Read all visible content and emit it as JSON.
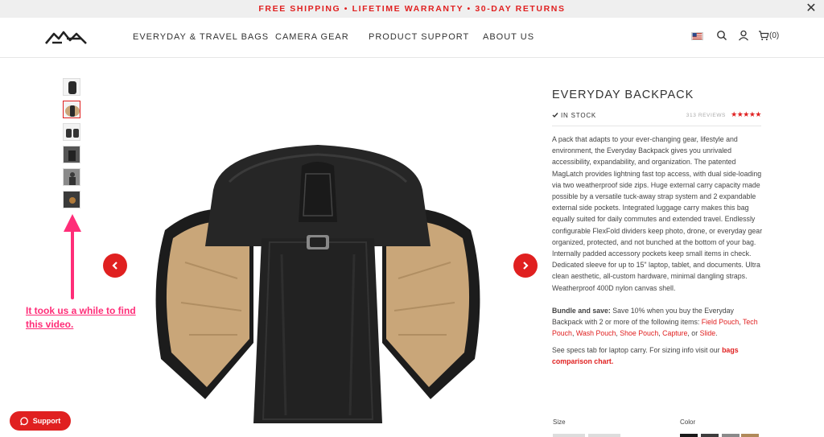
{
  "promo": {
    "text": "FREE SHIPPING • LIFETIME WARRANTY • 30-DAY RETURNS"
  },
  "header": {
    "nav": [
      {
        "label": "EVERYDAY & TRAVEL BAGS"
      },
      {
        "label": "CAMERA GEAR"
      },
      {
        "label": "PRODUCT SUPPORT"
      },
      {
        "label": "ABOUT US"
      }
    ],
    "cart_count": "(0)",
    "icons": [
      "flag-us-icon",
      "search-icon",
      "user-icon",
      "cart-icon"
    ]
  },
  "gallery": {
    "thumb_count": 6,
    "active_index": 1
  },
  "annotation": {
    "text": "It took us a while to find this video."
  },
  "product": {
    "title": "EVERYDAY BACKPACK",
    "stock": "IN STOCK",
    "reviews": "313 REVIEWS",
    "rating": 5,
    "description": "A pack that adapts to your ever-changing gear, lifestyle and environment, the Everyday Backpack gives you unrivaled accessibility, expandability, and organization. The patented MagLatch provides lightning fast top access, with dual side-loading via two weatherproof side zips. Huge external carry capacity made possible by a versatile tuck-away strap system and 2 expandable external side pockets. Integrated luggage carry makes this bag equally suited for daily commutes and extended travel. Endlessly configurable FlexFold dividers keep photo, drone, or everyday gear organized, protected, and not bunched at the bottom of your bag. Internally padded accessory pockets keep small items in check. Dedicated sleeve for up to 15\" laptop, tablet, and documents. Ultra clean aesthetic, all-custom hardware, minimal dangling straps. Weatherproof 400D nylon canvas shell.",
    "bundle": {
      "lead": "Bundle and save:",
      "text": " Save 10% when you buy the Everyday Backpack with 2 or more of the following items: ",
      "items": [
        "Field Pouch",
        "Tech Pouch",
        "Wash Pouch",
        "Shoe Pouch",
        "Capture",
        "Slide"
      ],
      "sep": ", ",
      "or": "or ",
      "end": "."
    },
    "specs": {
      "text": "See specs tab for laptop carry. For sizing info visit our ",
      "link": "bags comparison chart",
      "end": "."
    },
    "size_label": "Size",
    "color_label": "Color"
  },
  "colors": {
    "accent": "#e02020",
    "annotation": "#ff2d78",
    "swatches": [
      "#1a1a1a",
      "#3d3d3d",
      "#8a8a8a",
      "#b08a5a"
    ]
  },
  "support": {
    "label": "Support"
  }
}
